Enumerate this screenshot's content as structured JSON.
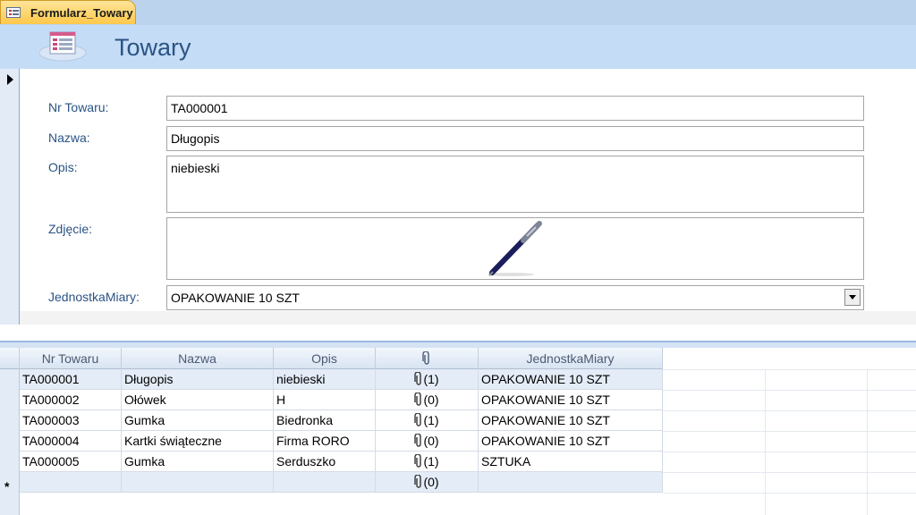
{
  "tab": {
    "label": "Formularz_Towary",
    "icon": "form-icon"
  },
  "header": {
    "title": "Towary",
    "icon": "form-icon"
  },
  "form": {
    "fields": [
      {
        "label": "Nr Towaru:",
        "value": "TA000001"
      },
      {
        "label": "Nazwa:",
        "value": "Długopis"
      },
      {
        "label": "Opis:",
        "value": "niebieski"
      },
      {
        "label": "Zdjęcie:",
        "value": ""
      },
      {
        "label": "JednostkaMiary:",
        "value": "OPAKOWANIE 10 SZT"
      }
    ],
    "image_icon": "pen-image"
  },
  "datasheet": {
    "columns": [
      "Nr Towaru",
      "Nazwa",
      "Opis",
      "",
      "JednostkaMiary"
    ],
    "attachment_icon": "paperclip-icon",
    "rows": [
      {
        "nr": "TA000001",
        "nazwa": "Długopis",
        "opis": "niebieski",
        "att": "(1)",
        "jm": "OPAKOWANIE 10 SZT"
      },
      {
        "nr": "TA000002",
        "nazwa": "Ołówek",
        "opis": "H",
        "att": "(0)",
        "jm": "OPAKOWANIE 10 SZT"
      },
      {
        "nr": "TA000003",
        "nazwa": "Gumka",
        "opis": "Biedronka",
        "att": "(1)",
        "jm": "OPAKOWANIE 10 SZT"
      },
      {
        "nr": "TA000004",
        "nazwa": "Kartki świąteczne",
        "opis": "Firma RORO",
        "att": "(0)",
        "jm": "OPAKOWANIE 10 SZT"
      },
      {
        "nr": "TA000005",
        "nazwa": "Gumka",
        "opis": "Serduszko",
        "att": "(1)",
        "jm": "SZTUKA"
      }
    ],
    "new_row": {
      "marker": "*",
      "att": "(0)"
    }
  }
}
